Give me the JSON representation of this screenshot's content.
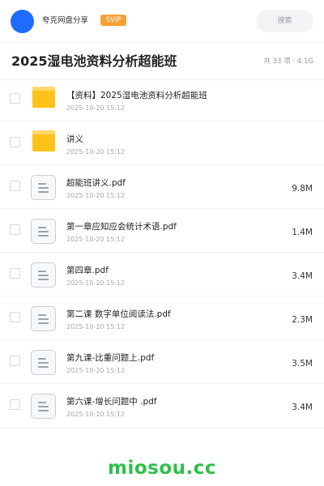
{
  "header": {
    "app_name": "夸克网盘分享",
    "badge": "SVIP",
    "search_placeholder": "搜索"
  },
  "folder": {
    "title": "2025湿电池资料分析超能班",
    "meta": "共 33 项 · 4.1G"
  },
  "items": [
    {
      "type": "folder",
      "name": "【资料】2025湿电池资料分析超能班",
      "date": "2025-10-20 15:12",
      "size": ""
    },
    {
      "type": "folder",
      "name": "讲义",
      "date": "2025-10-20 15:12",
      "size": ""
    },
    {
      "type": "file",
      "name": "超能班讲义.pdf",
      "date": "2025-10-20 15:12",
      "size": "9.8M"
    },
    {
      "type": "file",
      "name": "第一章应知应会统计术语.pdf",
      "date": "2025-10-20 15:12",
      "size": "1.4M"
    },
    {
      "type": "file",
      "name": "第四章.pdf",
      "date": "2025-10-20 15:12",
      "size": "3.4M"
    },
    {
      "type": "file",
      "name": "第二课 数字单位阅读法.pdf",
      "date": "2025-10-20 15:12",
      "size": "2.3M"
    },
    {
      "type": "file",
      "name": "第九课-比重问题上.pdf",
      "date": "2025-10-20 15:12",
      "size": "3.5M"
    },
    {
      "type": "file",
      "name": "第六课-增长问题中 .pdf",
      "date": "2025-10-20 15:12",
      "size": "3.4M"
    }
  ],
  "watermark": "miosou.cc",
  "colors": {
    "avatar": "#1f6bff",
    "badge": "#f6a136",
    "folder": "#ffc21a",
    "watermark": "#2fbf4a"
  }
}
